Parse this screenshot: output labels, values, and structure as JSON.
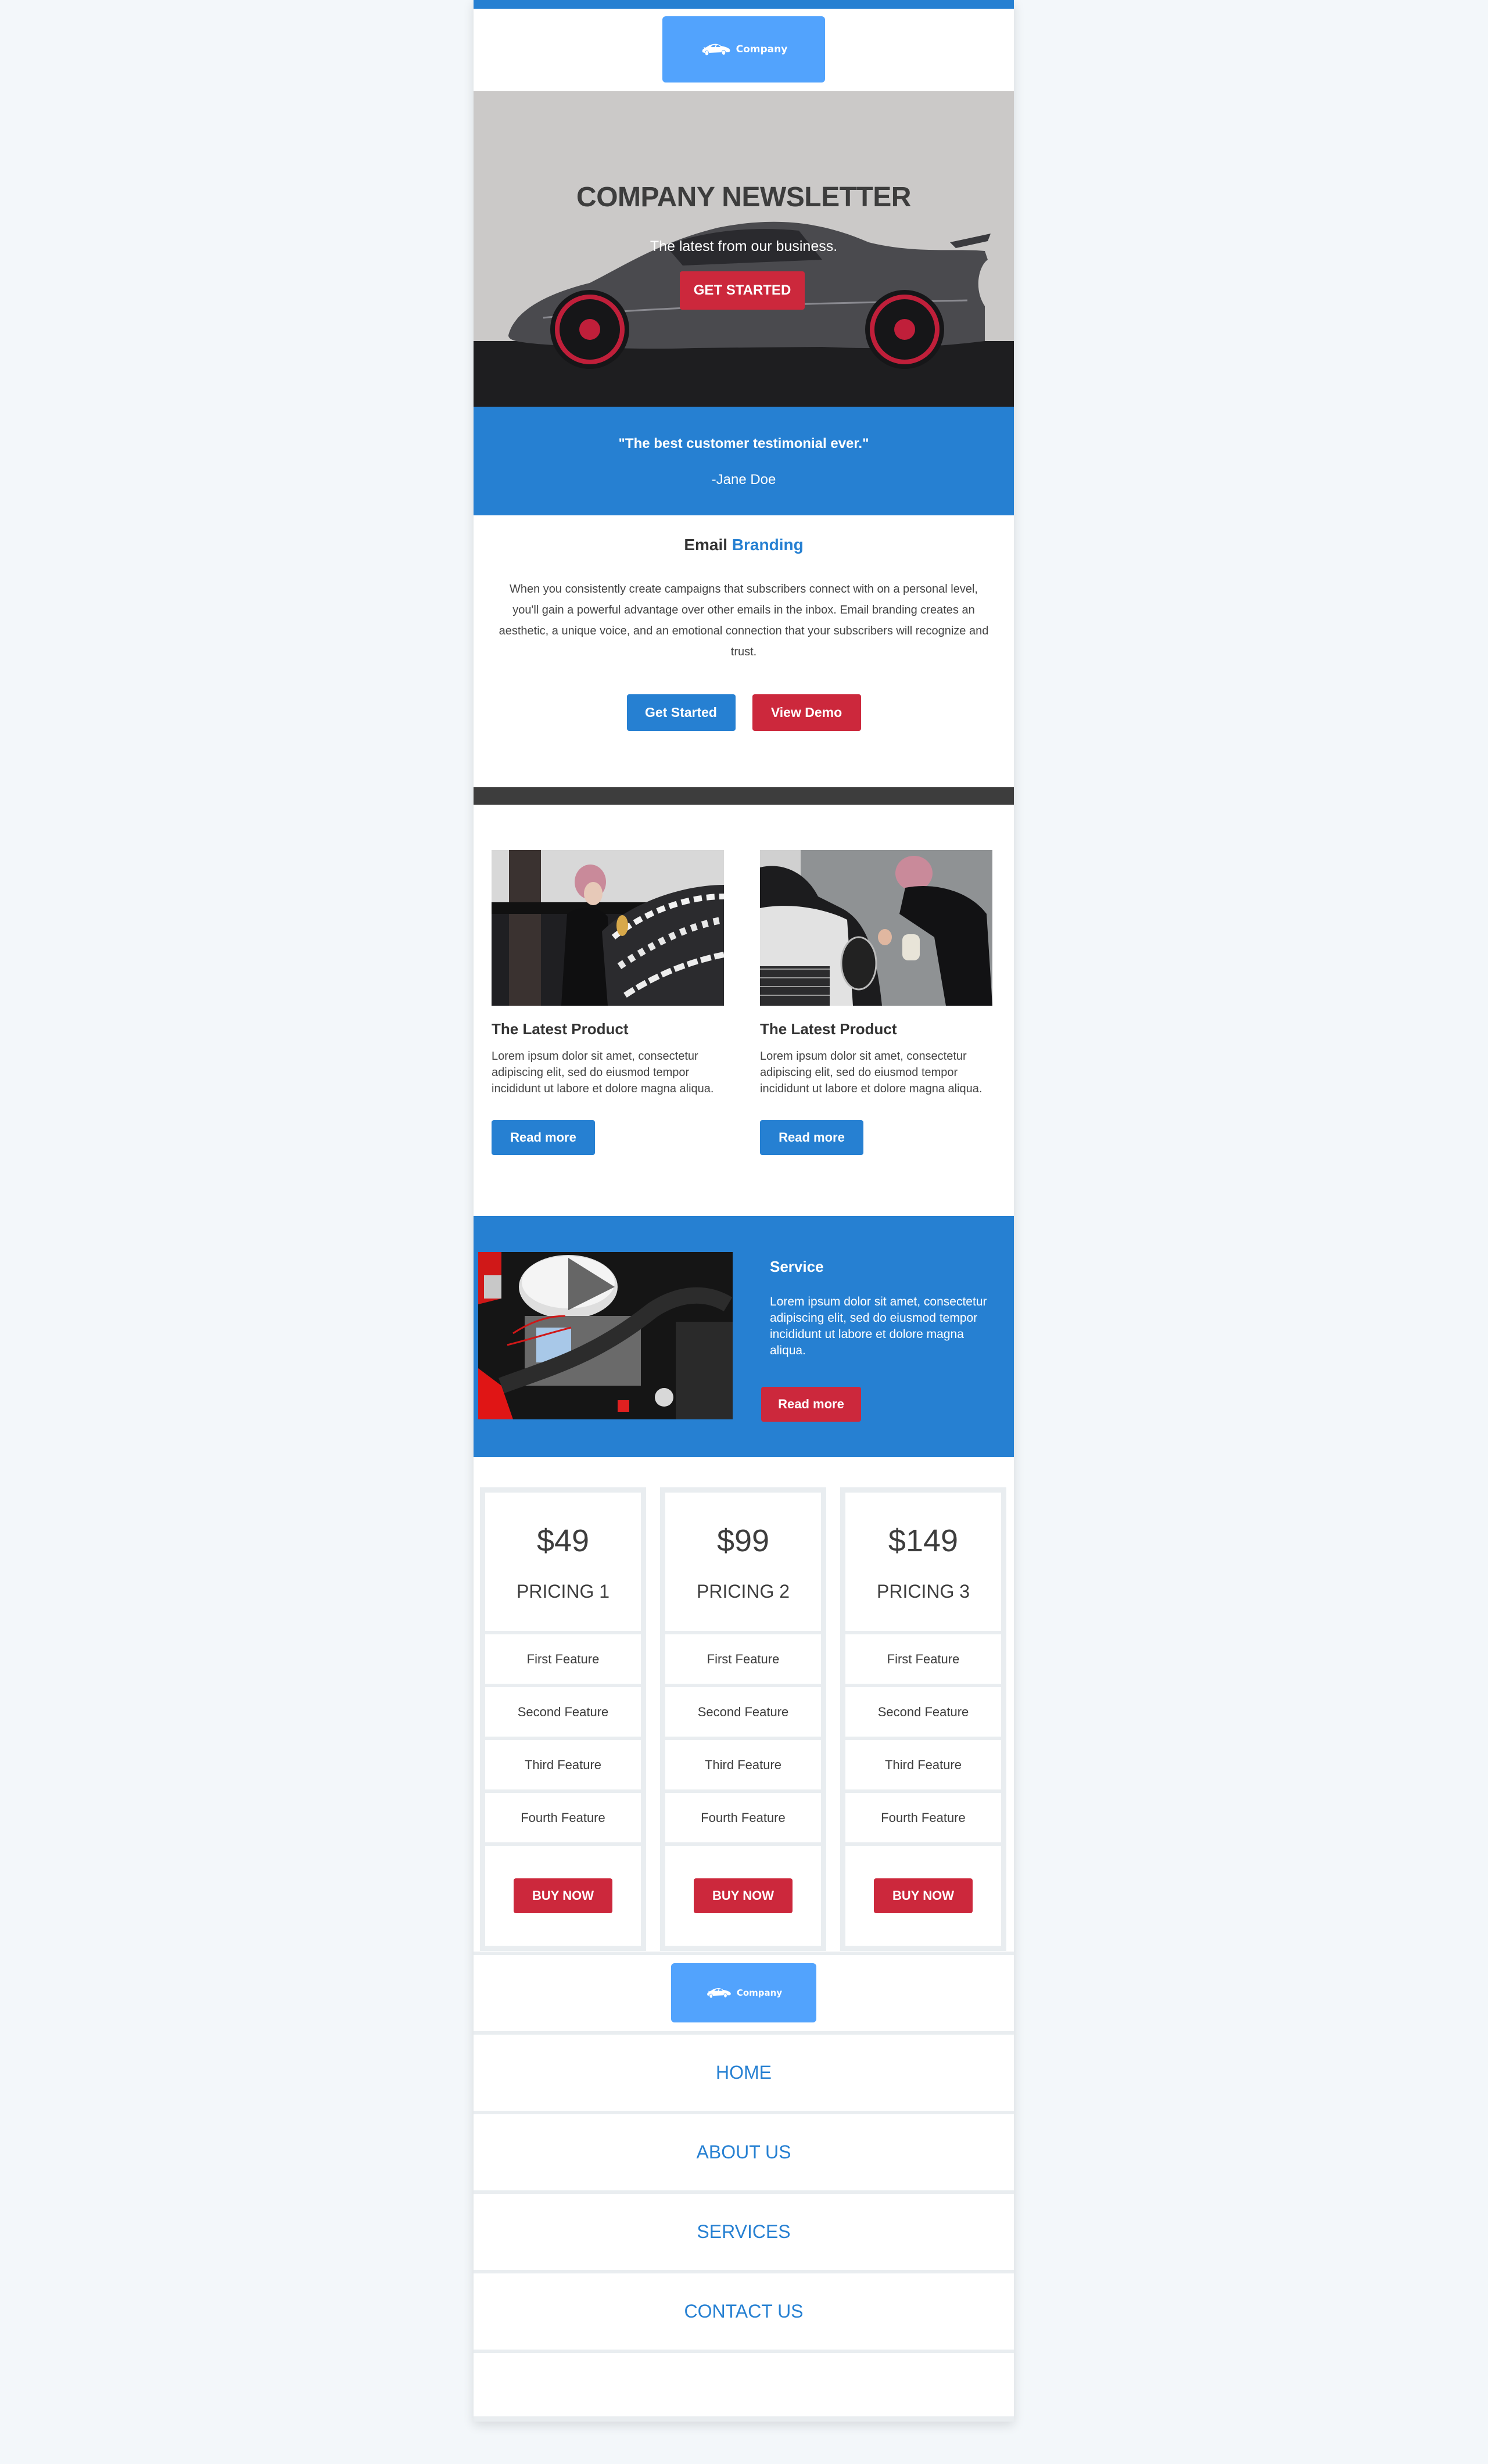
{
  "header": {
    "logo_text": "Company"
  },
  "hero": {
    "title": "COMPANY NEWSLETTER",
    "subtitle": "The latest from our business.",
    "cta_label": "GET STARTED"
  },
  "testimonial": {
    "quote": "\"The best customer testimonial ever.\"",
    "author": "-Jane Doe"
  },
  "branding": {
    "title_prefix": "Email",
    "title_accent": "Branding",
    "body": "When you consistently create campaigns that subscribers connect with on a personal level, you'll gain a powerful advantage over other emails in the inbox. Email branding creates an aesthetic, a unique voice, and an emotional connection that your subscribers will recognize and trust.",
    "primary_label": "Get Started",
    "secondary_label": "View Demo"
  },
  "products": [
    {
      "title": "The Latest Product",
      "body": "Lorem ipsum dolor sit amet, consectetur adipiscing elit, sed do eiusmod tempor incididunt ut labore et dolore magna aliqua.",
      "button_label": "Read more"
    },
    {
      "title": "The Latest Product",
      "body": "Lorem ipsum dolor sit amet, consectetur adipiscing elit, sed do eiusmod tempor incididunt ut labore et dolore magna aliqua.",
      "button_label": "Read more"
    }
  ],
  "service": {
    "title": "Service",
    "body": "Lorem ipsum dolor sit amet, consectetur adipiscing elit, sed do eiusmod tempor incididunt ut labore et dolore magna aliqua.",
    "button_label": "Read more"
  },
  "pricing": [
    {
      "price": "$49",
      "name": "PRICING 1",
      "features": [
        "First Feature",
        "Second Feature",
        "Third Feature",
        "Fourth Feature"
      ],
      "button_label": "BUY NOW"
    },
    {
      "price": "$99",
      "name": "PRICING 2",
      "features": [
        "First Feature",
        "Second Feature",
        "Third Feature",
        "Fourth Feature"
      ],
      "button_label": "BUY NOW"
    },
    {
      "price": "$149",
      "name": "PRICING 3",
      "features": [
        "First Feature",
        "Second Feature",
        "Third Feature",
        "Fourth Feature"
      ],
      "button_label": "BUY NOW"
    }
  ],
  "footer": {
    "logo_text": "Company",
    "nav": [
      {
        "label": "HOME"
      },
      {
        "label": "ABOUT US"
      },
      {
        "label": "SERVICES"
      },
      {
        "label": "CONTACT US"
      }
    ]
  },
  "colors": {
    "primary_blue": "#2680d2",
    "logo_blue": "#52a3fd",
    "accent_red": "#cc283c",
    "dark_bar": "#3d3d3d",
    "page_background": "#f3f7fa",
    "border_gray": "#e9edf0"
  },
  "icons": {
    "logo": "car-silhouette-icon"
  }
}
